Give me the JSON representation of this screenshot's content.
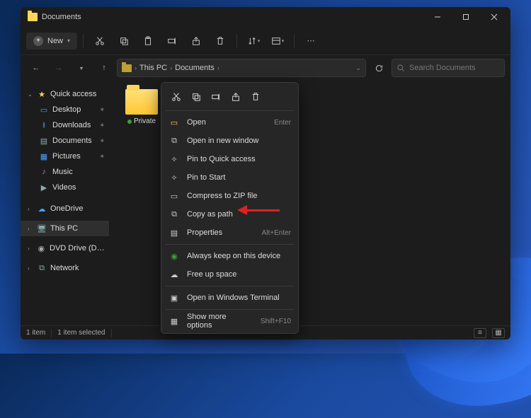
{
  "titlebar": {
    "title": "Documents"
  },
  "toolbar": {
    "new_label": "New",
    "icons": [
      "cut",
      "copy",
      "paste",
      "rename",
      "share",
      "delete",
      "sort",
      "view",
      "more"
    ]
  },
  "nav": {
    "breadcrumb": [
      "This PC",
      "Documents"
    ],
    "refresh": "refresh"
  },
  "search": {
    "placeholder": "Search Documents"
  },
  "sidebar": {
    "quick_access": "Quick access",
    "items": [
      {
        "icon": "desktop-icon",
        "label": "Desktop",
        "pinned": true
      },
      {
        "icon": "download-icon",
        "label": "Downloads",
        "pinned": true
      },
      {
        "icon": "documents-icon",
        "label": "Documents",
        "pinned": true
      },
      {
        "icon": "pictures-icon",
        "label": "Pictures",
        "pinned": true
      },
      {
        "icon": "music-icon",
        "label": "Music",
        "pinned": false
      },
      {
        "icon": "videos-icon",
        "label": "Videos",
        "pinned": false
      }
    ],
    "onedrive": "OneDrive",
    "thispc": "This PC",
    "dvd": "DVD Drive (D:) ESD-…",
    "network": "Network"
  },
  "content": {
    "folder": {
      "name": "Private",
      "status": "available"
    }
  },
  "context_menu": {
    "top_icons": [
      "cut",
      "copy",
      "rename",
      "share",
      "delete"
    ],
    "items": [
      {
        "icon": "open-icon",
        "label": "Open",
        "shortcut": "Enter"
      },
      {
        "icon": "new-window-icon",
        "label": "Open in new window",
        "shortcut": ""
      },
      {
        "icon": "pin-quick-icon",
        "label": "Pin to Quick access",
        "shortcut": ""
      },
      {
        "icon": "pin-start-icon",
        "label": "Pin to Start",
        "shortcut": ""
      },
      {
        "icon": "zip-icon",
        "label": "Compress to ZIP file",
        "shortcut": ""
      },
      {
        "icon": "copy-path-icon",
        "label": "Copy as path",
        "shortcut": ""
      },
      {
        "icon": "properties-icon",
        "label": "Properties",
        "shortcut": "Alt+Enter"
      }
    ],
    "group2": [
      {
        "icon": "keep-device-icon",
        "label": "Always keep on this device"
      },
      {
        "icon": "free-space-icon",
        "label": "Free up space"
      }
    ],
    "group3": [
      {
        "icon": "terminal-icon",
        "label": "Open in Windows Terminal"
      }
    ],
    "group4": [
      {
        "icon": "more-options-icon",
        "label": "Show more options",
        "shortcut": "Shift+F10"
      }
    ]
  },
  "status": {
    "count": "1 item",
    "selected": "1 item selected"
  }
}
